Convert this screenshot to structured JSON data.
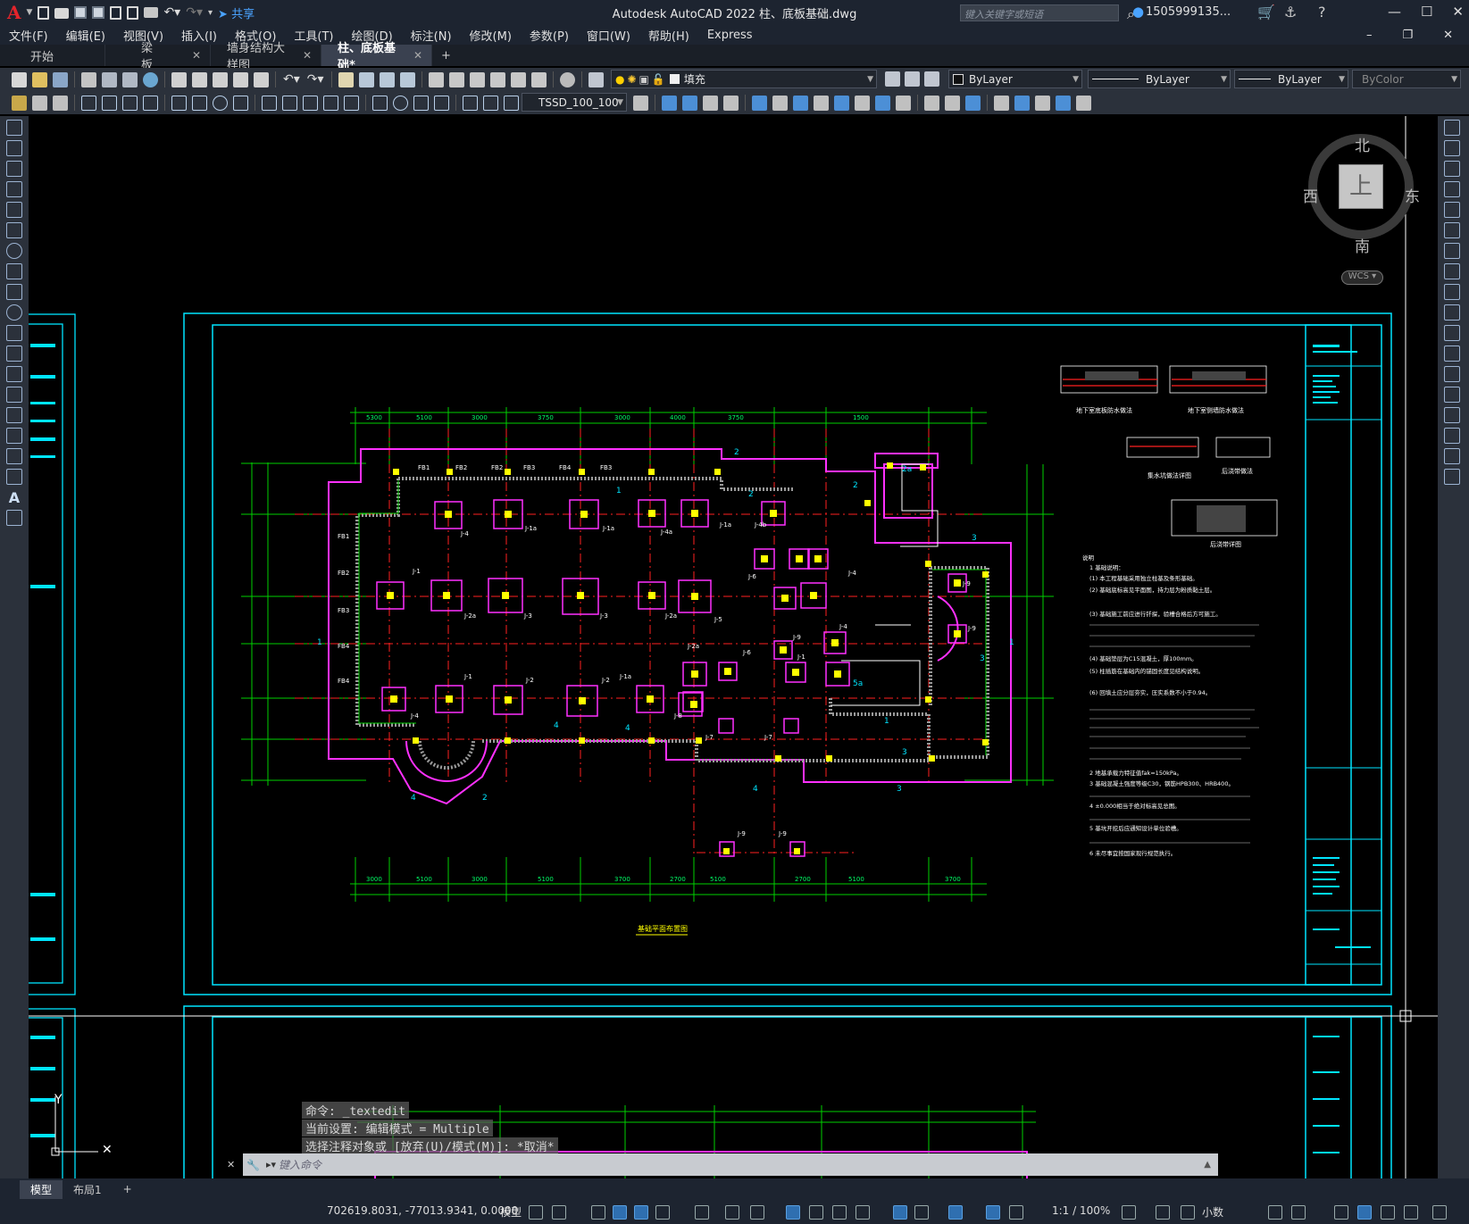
{
  "app": {
    "title": "Autodesk AutoCAD 2022    柱、底板基础.dwg",
    "share": "共享",
    "search_placeholder": "键入关键字或短语",
    "user": "1505999135...",
    "logo": "A"
  },
  "menu": [
    "文件(F)",
    "编辑(E)",
    "视图(V)",
    "插入(I)",
    "格式(O)",
    "工具(T)",
    "绘图(D)",
    "标注(N)",
    "修改(M)",
    "参数(P)",
    "窗口(W)",
    "帮助(H)",
    "Express"
  ],
  "tabs": [
    {
      "label": "开始",
      "closable": false
    },
    {
      "label": "梁板",
      "closable": true
    },
    {
      "label": "墙身结构大样图",
      "closable": true
    },
    {
      "label": "柱、底板基础*",
      "closable": true,
      "active": true
    }
  ],
  "toolbar": {
    "layer": "填充",
    "color": "ByLayer",
    "linetype": "ByLayer",
    "lineweight": "ByLayer",
    "plotstyle": "ByColor",
    "textstyle": "TSSD_100_100"
  },
  "viewcube": {
    "top": "上",
    "north": "北",
    "south": "南",
    "east": "东",
    "west": "西",
    "wcs": "WCS"
  },
  "drawing": {
    "title": "基础平面布置图",
    "notes_title": "说明",
    "notes": [
      "1 基础说明：",
      "(1) 本工程基础采用独立柱基及条形基础。",
      "(2) 基础底标高见平面图，持力层为粉质黏土层。",
      "(3) 基础施工前应进行钎探，验槽合格后方可施工。",
      "(4) 基础垫层为C15混凝土，厚100mm。",
      "(5) 柱插筋在基础内的锚固长度见结构说明。",
      "(6) 回填土应分层夯实，压实系数不小于0.94。",
      "2 地基承载力特征值fak=150kPa。",
      "3 基础混凝土强度等级C30，钢筋HPB300、HRB400。",
      "4 ±0.000相当于绝对标高见总图。",
      "5 基坑开挖后应通知设计单位验槽。",
      "6 未尽事宜按国家现行规范执行。"
    ],
    "dims_top": [
      "5300",
      "5100",
      "3000",
      "3750",
      "3000",
      "4000",
      "3750",
      "1500"
    ],
    "dims_bottom": [
      "3000",
      "5100",
      "3000",
      "5100",
      "3700",
      "2700",
      "5100",
      "2700",
      "5100",
      "3700"
    ],
    "col_labels": [
      "J-1",
      "J-1a",
      "J-2",
      "J-2a",
      "J-3",
      "J-4",
      "J-4a",
      "J-4b",
      "J-5",
      "J-6",
      "J-7",
      "J-8",
      "J-9"
    ],
    "fbs": [
      "FB1",
      "FB2",
      "FB3",
      "FB4"
    ],
    "small_details": [
      "地下室底板防水做法",
      "地下室侧墙防水做法",
      "集水坑做法详图",
      "后浇带做法",
      "后浇带详图"
    ]
  },
  "command": {
    "line1": "命令: _textedit",
    "line2": "当前设置: 编辑模式 = Multiple",
    "line3": "选择注释对象或 [放弃(U)/模式(M)]: *取消*",
    "placeholder": "键入命令"
  },
  "layouts": [
    "模型",
    "布局1",
    "+"
  ],
  "status": {
    "coords": "702619.8031, -77013.9341, 0.0000",
    "space": "模型",
    "scale": "1:1 / 100%",
    "units": "小数"
  }
}
